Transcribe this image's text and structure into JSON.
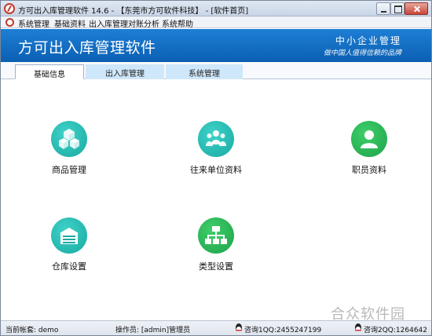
{
  "window": {
    "title": "方可出入库管理软件 14.6 - 【东莞市方可软件科技】 - [软件首页]"
  },
  "menu": {
    "items": [
      "系统管理",
      "基础资料",
      "出入库管理",
      "对账分析",
      "系统帮助"
    ]
  },
  "banner": {
    "title": "方可出入库管理软件",
    "slogan_line1": "中小企业管理",
    "slogan_line2": "做中国人值得信赖的品牌"
  },
  "tabs": [
    {
      "label": "基础信息",
      "active": true
    },
    {
      "label": "出入库管理",
      "active": false
    },
    {
      "label": "系统管理",
      "active": false
    }
  ],
  "modules": [
    {
      "label": "商品管理",
      "icon": "boxes-icon",
      "color": "#19aaa2"
    },
    {
      "label": "往来单位资料",
      "icon": "people-group-icon",
      "color": "#19aaa2"
    },
    {
      "label": "职员资料",
      "icon": "user-icon",
      "color": "#1ea24a"
    },
    {
      "label": "仓库设置",
      "icon": "warehouse-icon",
      "color": "#19aaa2"
    },
    {
      "label": "类型设置",
      "icon": "hierarchy-icon",
      "color": "#1ea24a"
    }
  ],
  "watermark": "合众软件园",
  "status": {
    "account": "当前帐套: demo",
    "operator": "操作员: [admin]管理员",
    "qq1": "咨询1QQ:2455247199",
    "qq2": "咨询2QQ:1264642"
  }
}
